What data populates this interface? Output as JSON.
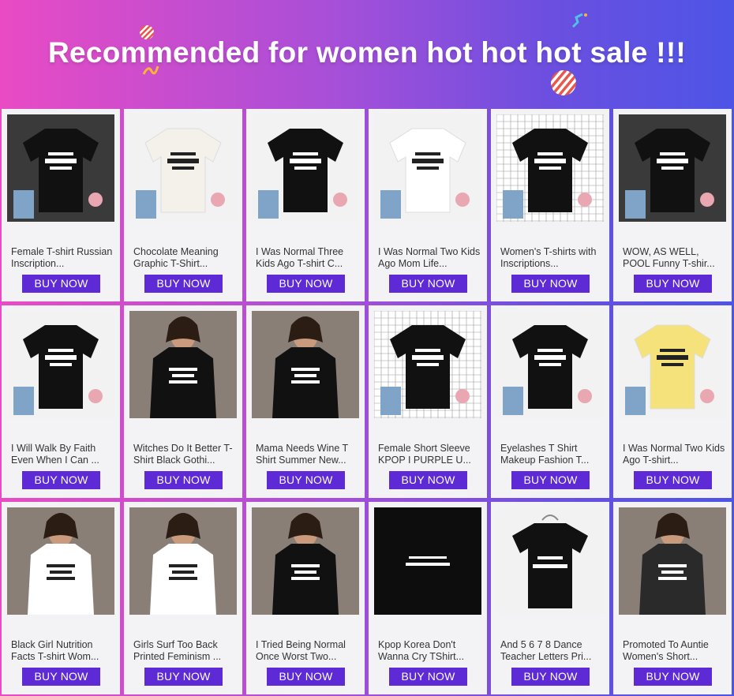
{
  "banner": {
    "title": "Recommended for women hot hot hot sale !!!"
  },
  "buy_label": "BUY NOW",
  "products": [
    {
      "title": "Female T-shirt Russian Inscription...",
      "image": "collage-black-tees",
      "shirt_color": "#111111"
    },
    {
      "title": "Chocolate Meaning Graphic T-Shirt...",
      "image": "white-tee-chocolate",
      "shirt_color": "#f4f0ea"
    },
    {
      "title": "I Was Normal Three Kids Ago T-shirt C...",
      "image": "black-tee-flatlay",
      "shirt_color": "#111111"
    },
    {
      "title": "I Was Normal Two Kids Ago Mom Life...",
      "image": "white-tee-flatlay",
      "shirt_color": "#ffffff"
    },
    {
      "title": "Women's T-shirts with Inscriptions...",
      "image": "black-tee-on-grid",
      "shirt_color": "#111111"
    },
    {
      "title": "WOW, AS WELL, POOL Funny T-shir...",
      "image": "collage-black-tees",
      "shirt_color": "#111111"
    },
    {
      "title": "I Will Walk By Faith Even When I Can ...",
      "image": "black-tee-flatlay",
      "shirt_color": "#111111"
    },
    {
      "title": "Witches Do It Better T-Shirt Black Gothi...",
      "image": "model-black-tee",
      "shirt_color": "#111111"
    },
    {
      "title": "Mama Needs Wine T Shirt Summer New...",
      "image": "model-black-tee",
      "shirt_color": "#111111"
    },
    {
      "title": "Female Short Sleeve KPOP I PURPLE U...",
      "image": "black-tee-on-grid",
      "shirt_color": "#111111"
    },
    {
      "title": "Eyelashes T Shirt Makeup Fashion T...",
      "image": "black-tee-flatlay",
      "shirt_color": "#111111"
    },
    {
      "title": "I Was Normal Two Kids Ago T-shirt...",
      "image": "yellow-tee-flatlay",
      "shirt_color": "#f6e27a"
    },
    {
      "title": "Black Girl Nutrition Facts T-shirt Wom...",
      "image": "model-white-tee",
      "shirt_color": "#ffffff"
    },
    {
      "title": "Girls Surf Too Back Printed Feminism ...",
      "image": "model-white-tee-back",
      "shirt_color": "#ffffff"
    },
    {
      "title": "I Tried Being Normal Once Worst Two...",
      "image": "model-black-tee",
      "shirt_color": "#111111"
    },
    {
      "title": "Kpop Korea Don't Wanna Cry TShirt...",
      "image": "black-tee-closeup",
      "shirt_color": "#111111"
    },
    {
      "title": "And 5 6 7 8 Dance Teacher Letters Pri...",
      "image": "black-tee-hanger",
      "shirt_color": "#111111"
    },
    {
      "title": "Promoted To Auntie Women's Short...",
      "image": "model-black-tee",
      "shirt_color": "#2a2a2a"
    }
  ],
  "colors": {
    "button": "#5d2ad6",
    "card": "#f3f3f6",
    "banner_start": "#e94bc4",
    "banner_end": "#4d55e6"
  }
}
